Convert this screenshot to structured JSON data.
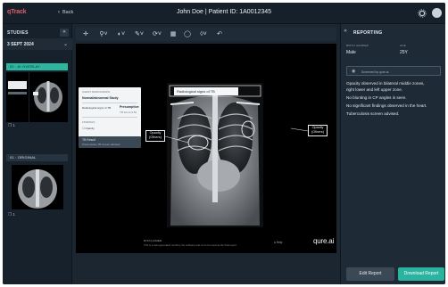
{
  "header": {
    "logo": "qTrack",
    "back_label": "Back",
    "title": "John Doe | Patient ID: 1A0012345"
  },
  "sidebar": {
    "heading": "STUDIES",
    "date": "3 SEPT 2024",
    "series": [
      {
        "label": "01 : AI OVERLAY",
        "count": "1"
      },
      {
        "label": "01 : ORIGINAL",
        "count": "1"
      }
    ]
  },
  "toolbar": {
    "icons": [
      "pan-icon",
      "zoom-icon",
      "contrast-icon",
      "annotate-icon",
      "rotate-icon",
      "grid-icon",
      "circle-icon",
      "layers-icon",
      "undo-icon"
    ]
  },
  "viewer": {
    "tooltip": {
      "header": "CHEST RADIOGRAPH",
      "title": "Normal/abnormal Study",
      "row_label": "Radiological signs of TB",
      "row_value": "Presumptive",
      "row_sub": "TB Score 0.81",
      "section": "FINDINGS",
      "item": "Opacity"
    },
    "dark_box": {
      "title": "TB Result",
      "sub": "Presumptive TB screen advised"
    },
    "annotations": {
      "top": "Radiological signs of TB",
      "left": [
        "Opacity",
        "(Others)"
      ],
      "right": [
        "Opacity",
        "(Others)"
      ]
    },
    "disclaimer_heading": "DISCLAIMER",
    "disclaimer": "This is a auto-generated result by the software and not to be used as the final report.",
    "help": "Help",
    "brand": "qure.ai"
  },
  "report": {
    "heading": "REPORTING",
    "fields": [
      {
        "label": "BIRTH GENDER",
        "value": "Male"
      },
      {
        "label": "AGE",
        "value": "25Y"
      }
    ],
    "screened_by": "Screened by qure.ai",
    "findings": [
      "Opacity observed in bilateral middle zones,",
      "right lower and left upper zone.",
      "No blunting in CP angles is seen.",
      "No significant findings observed in the heart.",
      "Tuberculosis screen advised."
    ],
    "edit_button": "Edit Report",
    "download_button": "Download Report"
  },
  "colors": {
    "accent": "#2bb39f",
    "logo": "#e35d6a",
    "panel": "#1e2a36",
    "background": "#1b2631"
  }
}
